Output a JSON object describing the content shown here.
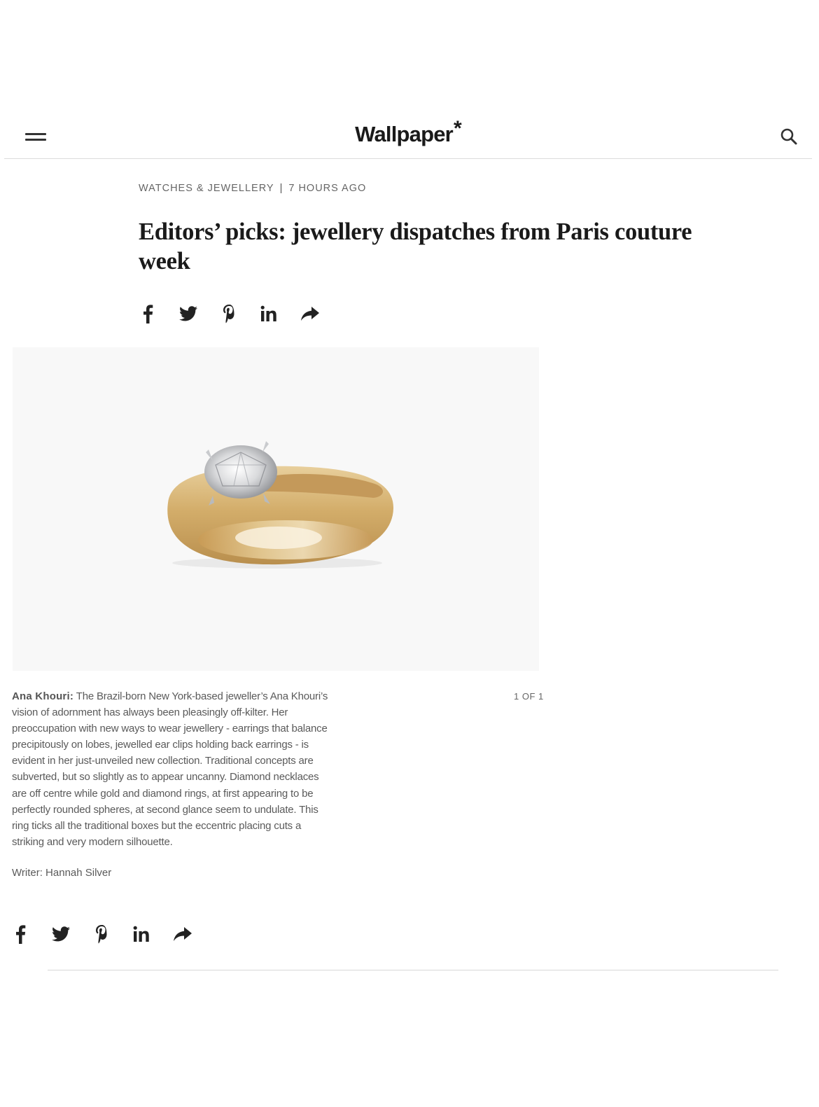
{
  "header": {
    "brand": "Wallpaper",
    "brand_mark": "*",
    "menu_icon": "hamburger-icon",
    "search_icon": "search-icon"
  },
  "article": {
    "category": "WATCHES & JEWELLERY",
    "separator": "|",
    "time_ago": "7 HOURS AGO",
    "title": "Editors’ picks: jewellery dispatches from Paris couture week",
    "share_icons": [
      "facebook-icon",
      "twitter-icon",
      "pinterest-icon",
      "linkedin-icon",
      "share-arrow-icon"
    ]
  },
  "gallery": {
    "counter": "1 OF 1",
    "caption_name": "Ana Khouri:",
    "caption_text": "The Brazil-born New York-based jeweller’s Ana Khouri’s vision of adornment has always been pleasingly off-kilter. Her preoccupation with new ways to wear jewellery - earrings that balance precipitously on lobes, jewelled ear clips holding back earrings - is evident in her just-unveiled new collection. Traditional concepts are subverted, but so slightly as to appear uncanny. Diamond necklaces are off centre while gold and diamond rings, at first appearing to be perfectly rounded spheres, at second glance seem to undulate. This ring ticks all the traditional boxes but the eccentric placing cuts a striking and very modern silhouette."
  },
  "writer": "Writer: Hannah Silver",
  "colors": {
    "text_dark": "#1a1a1a",
    "text_muted": "#5a5a5a",
    "image_bg": "#f8f8f8",
    "gold": "#d9b97a"
  }
}
